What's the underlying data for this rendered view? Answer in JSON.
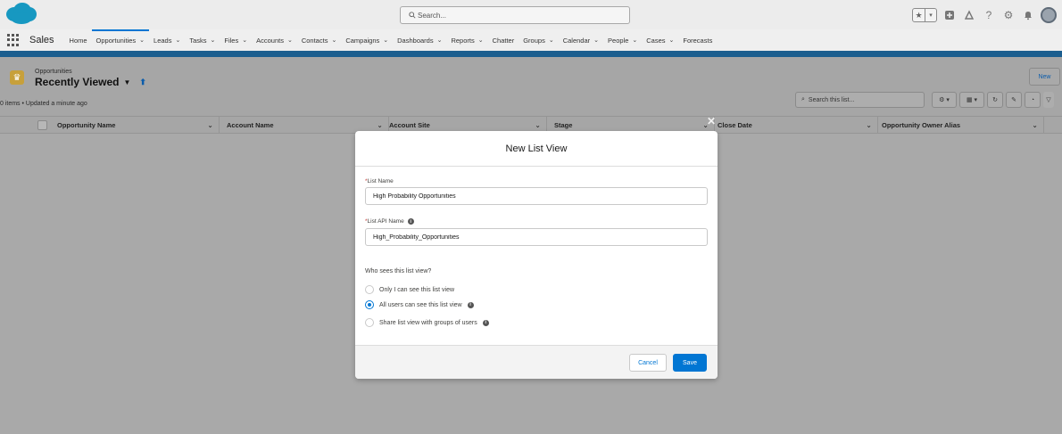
{
  "header": {
    "search_placeholder": "Search...",
    "icons": [
      "favorites-star-icon",
      "favorites-dropdown-icon",
      "global-actions-icon",
      "trailhead-icon",
      "help-icon",
      "setup-gear-icon",
      "notifications-bell-icon",
      "user-avatar"
    ]
  },
  "nav": {
    "app_name": "Sales",
    "items": [
      {
        "label": "Home",
        "dropdown": false
      },
      {
        "label": "Opportunities",
        "dropdown": true,
        "active": true
      },
      {
        "label": "Leads",
        "dropdown": true
      },
      {
        "label": "Tasks",
        "dropdown": true
      },
      {
        "label": "Files",
        "dropdown": true
      },
      {
        "label": "Accounts",
        "dropdown": true
      },
      {
        "label": "Contacts",
        "dropdown": true
      },
      {
        "label": "Campaigns",
        "dropdown": true
      },
      {
        "label": "Dashboards",
        "dropdown": true
      },
      {
        "label": "Reports",
        "dropdown": true
      },
      {
        "label": "Chatter",
        "dropdown": false
      },
      {
        "label": "Groups",
        "dropdown": true
      },
      {
        "label": "Calendar",
        "dropdown": true
      },
      {
        "label": "People",
        "dropdown": true
      },
      {
        "label": "Cases",
        "dropdown": true
      },
      {
        "label": "Forecasts",
        "dropdown": false
      }
    ]
  },
  "list_view": {
    "object_label": "Opportunities",
    "title": "Recently Viewed",
    "meta": "0 items • Updated a minute ago",
    "new_label": "New",
    "search_placeholder": "Search this list...",
    "columns": [
      "Opportunity Name",
      "Account Name",
      "Account Site",
      "Stage",
      "Close Date",
      "Opportunity Owner Alias"
    ]
  },
  "modal": {
    "title": "New List View",
    "list_name_label": "List Name",
    "list_name_value": "High Probability Opportunities",
    "api_name_label": "List API Name",
    "api_name_value": "High_Probability_Opportunities",
    "visibility_label": "Who sees this list view?",
    "options": [
      {
        "label": "Only I can see this list view",
        "selected": false,
        "info": false
      },
      {
        "label": "All users can see this list view",
        "selected": true,
        "info": true
      },
      {
        "label": "Share list view with groups of users",
        "selected": false,
        "info": true
      }
    ],
    "cancel_label": "Cancel",
    "save_label": "Save"
  },
  "colors": {
    "brand_blue": "#0176d3",
    "stripe": "#1b5e8f",
    "object_icon": "#c7a03b"
  }
}
